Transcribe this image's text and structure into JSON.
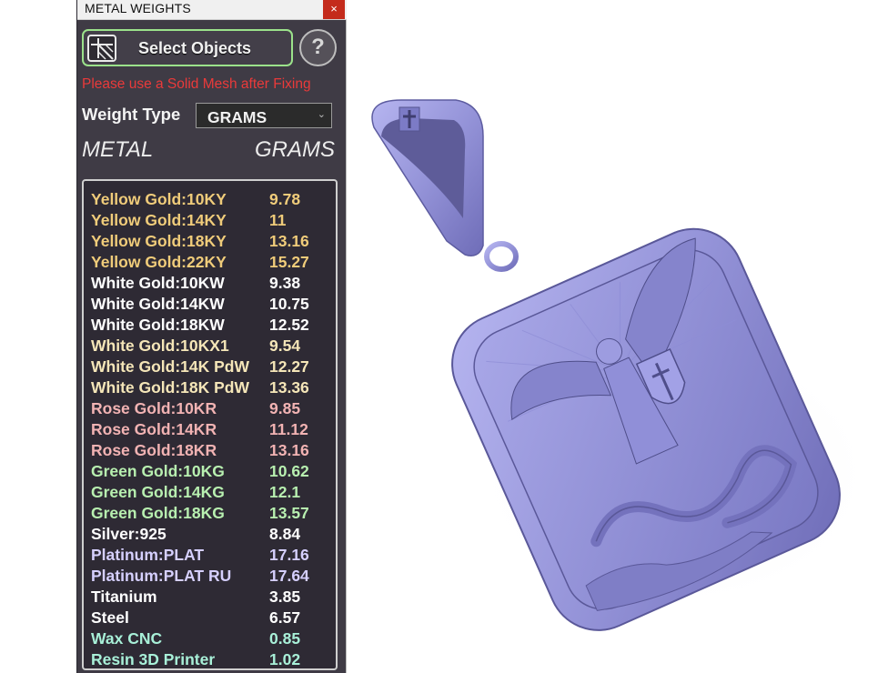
{
  "window": {
    "title": "METAL WEIGHTS",
    "close_glyph": "×"
  },
  "toolbar": {
    "select_label": "Select Objects",
    "help_glyph": "?",
    "warning": "Please use a Solid Mesh after Fixing"
  },
  "weight_type": {
    "label": "Weight Type",
    "value": "GRAMS",
    "chevron": "⌄"
  },
  "columns": {
    "metal": "METAL",
    "grams": "GRAMS"
  },
  "colors": {
    "yellow": "#f0cc7a",
    "white": "#ffffff",
    "cream": "#f5e6b8",
    "rose": "#f2b3b3",
    "green": "#b8f0b0",
    "lavender": "#d6d0ff",
    "aqua": "#a8f0d8",
    "warning": "#ea3a3a",
    "panel_bg": "#3f3b45",
    "button_border": "#9be28b",
    "pendant": "#9c9be0"
  },
  "metals": [
    {
      "name": "Yellow Gold:10KY",
      "grams": "9.78",
      "color": "yellow"
    },
    {
      "name": "Yellow Gold:14KY",
      "grams": "11",
      "color": "yellow"
    },
    {
      "name": "Yellow Gold:18KY",
      "grams": "13.16",
      "color": "yellow"
    },
    {
      "name": "Yellow Gold:22KY",
      "grams": "15.27",
      "color": "yellow"
    },
    {
      "name": "White Gold:10KW",
      "grams": "9.38",
      "color": "white"
    },
    {
      "name": "White Gold:14KW",
      "grams": "10.75",
      "color": "white"
    },
    {
      "name": "White Gold:18KW",
      "grams": "12.52",
      "color": "white"
    },
    {
      "name": "White Gold:10KX1",
      "grams": "9.54",
      "color": "cream"
    },
    {
      "name": "White Gold:14K PdW",
      "grams": "12.27",
      "color": "cream"
    },
    {
      "name": "White Gold:18K PdW",
      "grams": "13.36",
      "color": "cream"
    },
    {
      "name": "Rose Gold:10KR",
      "grams": "9.85",
      "color": "rose"
    },
    {
      "name": "Rose Gold:14KR",
      "grams": "11.12",
      "color": "rose"
    },
    {
      "name": "Rose Gold:18KR",
      "grams": "13.16",
      "color": "rose"
    },
    {
      "name": "Green Gold:10KG",
      "grams": "10.62",
      "color": "green"
    },
    {
      "name": "Green Gold:14KG",
      "grams": "12.1",
      "color": "green"
    },
    {
      "name": "Green Gold:18KG",
      "grams": "13.57",
      "color": "green"
    },
    {
      "name": "Silver:925",
      "grams": "8.84",
      "color": "white"
    },
    {
      "name": "Platinum:PLAT",
      "grams": "17.16",
      "color": "lavender"
    },
    {
      "name": "Platinum:PLAT RU",
      "grams": "17.64",
      "color": "lavender"
    },
    {
      "name": "Titanium",
      "grams": "3.85",
      "color": "white"
    },
    {
      "name": "Steel",
      "grams": "6.57",
      "color": "white"
    },
    {
      "name": "Wax  CNC",
      "grams": "0.85",
      "color": "aqua"
    },
    {
      "name": "Resin 3D Printer",
      "grams": "1.02",
      "color": "aqua"
    }
  ]
}
